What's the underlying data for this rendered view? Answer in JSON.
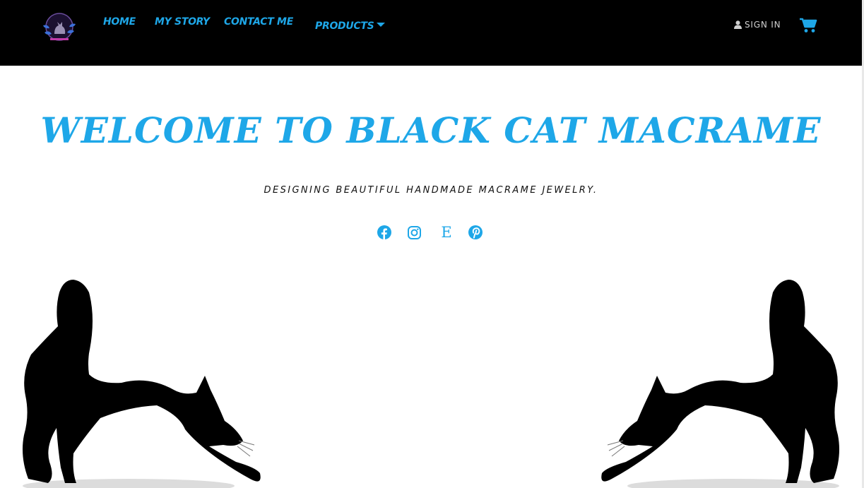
{
  "nav": {
    "home": "HOME",
    "my_story": "MY STORY",
    "contact": "CONTACT ME",
    "products": "PRODUCTS",
    "sign_in": "SIGN IN"
  },
  "hero": {
    "title": "WELCOME TO BLACK CAT MACRAME",
    "subtitle": "DESIGNING BEAUTIFUL HANDMADE MACRAME JEWELRY."
  },
  "social": {
    "etsy_letter": "E",
    "icons": [
      "facebook-icon",
      "instagram-icon",
      "etsy-icon",
      "pinterest-icon"
    ]
  },
  "colors": {
    "accent": "#1ea7e8",
    "navbar_bg": "#000000",
    "page_bg": "#ffffff"
  }
}
